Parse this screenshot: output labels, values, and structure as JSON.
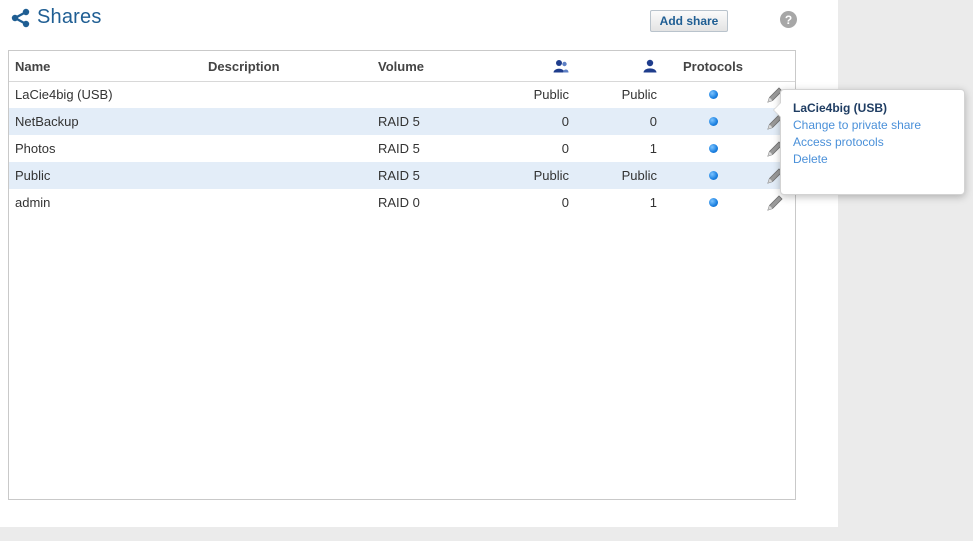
{
  "header": {
    "title": "Shares",
    "add_label": "Add share",
    "help_glyph": "?",
    "share_icon": "share-icon",
    "help_icon": "help-icon"
  },
  "table": {
    "columns": {
      "name": "Name",
      "description": "Description",
      "volume": "Volume",
      "groups_icon": "users-group-icon",
      "user_icon": "user-icon",
      "protocols": "Protocols"
    },
    "rows": [
      {
        "name": "LaCie4big (USB)",
        "description": "",
        "volume": "",
        "groups": "Public",
        "users": "Public"
      },
      {
        "name": "NetBackup",
        "description": "",
        "volume": "RAID 5",
        "groups": "0",
        "users": "0"
      },
      {
        "name": "Photos",
        "description": "",
        "volume": "RAID 5",
        "groups": "0",
        "users": "1"
      },
      {
        "name": "Public",
        "description": "",
        "volume": "RAID 5",
        "groups": "Public",
        "users": "Public"
      },
      {
        "name": "admin",
        "description": "",
        "volume": "RAID 0",
        "groups": "0",
        "users": "1"
      }
    ]
  },
  "popover": {
    "title": "LaCie4big (USB)",
    "items": [
      "Change to private share",
      "Access protocols",
      "Delete"
    ]
  },
  "colors": {
    "accent": "#1f5e93",
    "row_alt": "#e3edf8",
    "link": "#4a90d9",
    "protocol_dot": "#1a7fe0"
  }
}
